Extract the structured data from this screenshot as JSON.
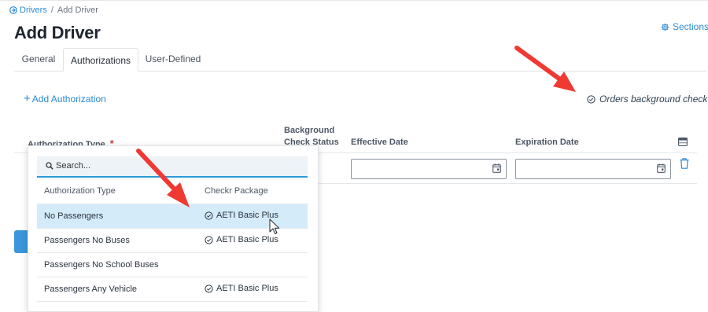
{
  "breadcrumb": {
    "parent": "Drivers",
    "separator": "/",
    "current": "Add Driver"
  },
  "page": {
    "title": "Add Driver",
    "sections_label": "Sections"
  },
  "tabs": [
    {
      "label": "General",
      "active": false
    },
    {
      "label": "Authorizations",
      "active": true
    },
    {
      "label": "User-Defined",
      "active": false
    }
  ],
  "actions": {
    "add_authorization": "Add Authorization",
    "background_check": "Orders background check"
  },
  "table": {
    "headers": {
      "authorization_type": "Authorization Type",
      "required_marker": "*",
      "background_check_line1": "Background",
      "background_check_line2": "Check Status",
      "effective_date": "Effective Date",
      "expiration_date": "Expiration Date"
    },
    "row": {
      "effective_date": "",
      "expiration_date": ""
    }
  },
  "dropdown": {
    "search_placeholder": "Search...",
    "col_type": "Authorization Type",
    "col_package": "Checkr Package",
    "items": [
      {
        "type": "No Passengers",
        "package": "AETI Basic Plus",
        "selected": true
      },
      {
        "type": "Passengers No Buses",
        "package": "AETI Basic Plus",
        "selected": false
      },
      {
        "type": "Passengers No School Buses",
        "package": "",
        "selected": false
      },
      {
        "type": "Passengers Any Vehicle",
        "package": "AETI Basic Plus",
        "selected": false
      }
    ]
  },
  "colors": {
    "accent": "#2b8bd6",
    "selected_row": "#d4ebf9",
    "annotation_arrow": "#ef3a33",
    "required": "#d63b3b"
  },
  "icons": [
    "drivers-icon",
    "gear-icon",
    "check-circle-icon",
    "calendar-icon",
    "trash-icon",
    "column-settings-icon",
    "search-icon",
    "mouse-pointer-icon"
  ]
}
